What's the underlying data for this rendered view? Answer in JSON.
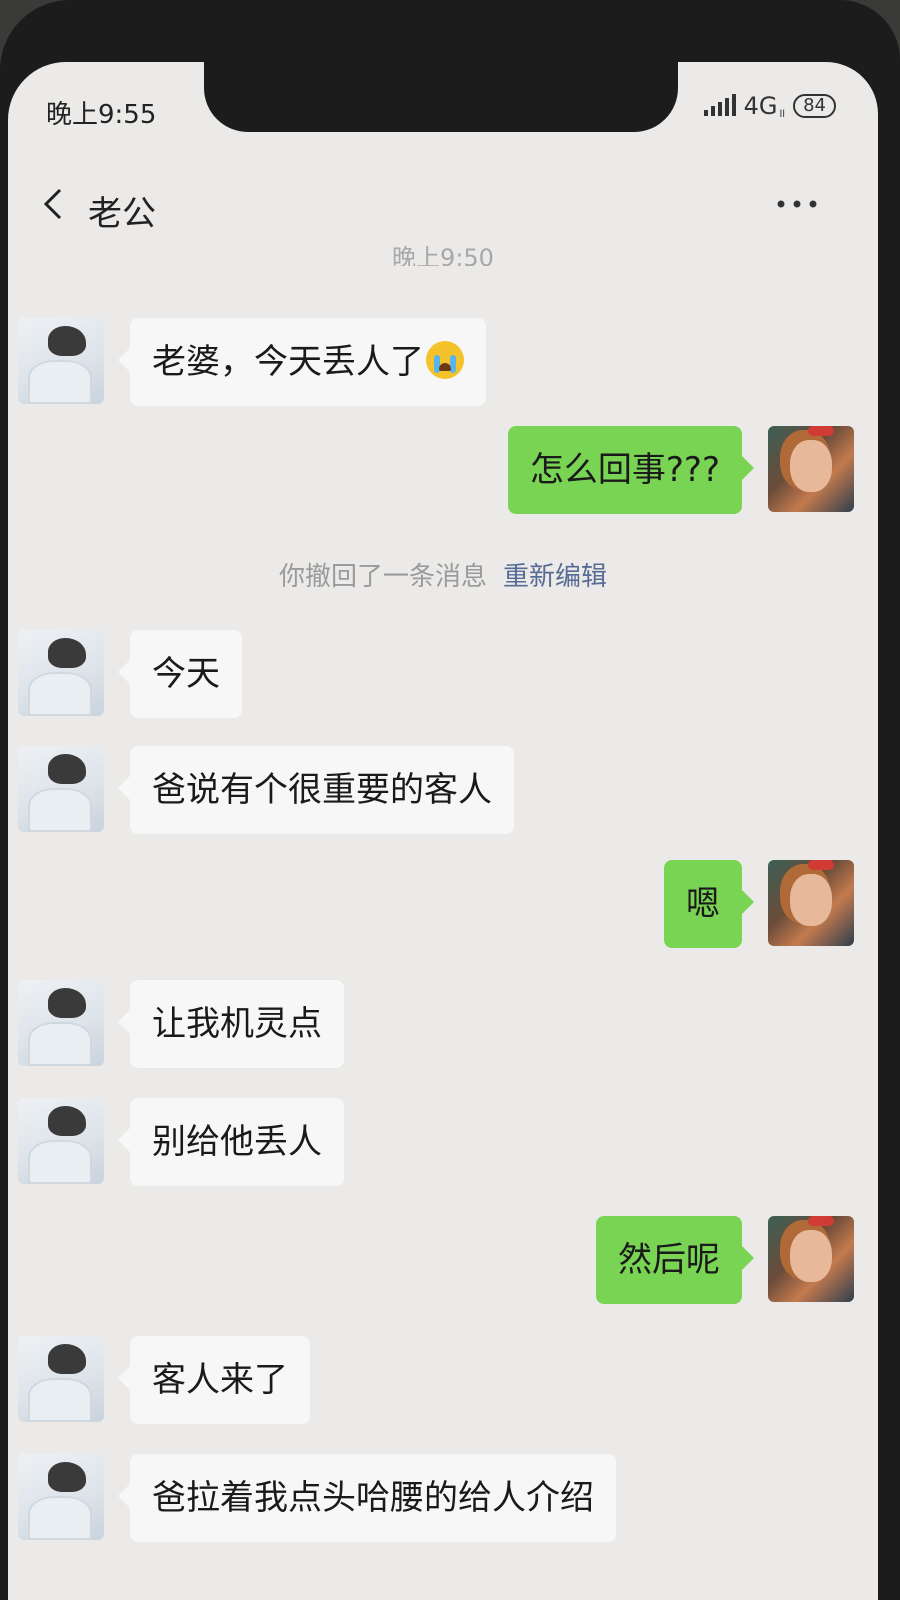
{
  "status_bar": {
    "time": "晚上9:55",
    "network": "4G",
    "network_sub": "ll",
    "battery": "84"
  },
  "header": {
    "back_icon": "chevron-left-icon",
    "title": "老公",
    "more_icon": "more-dots-icon"
  },
  "timestamp": "晚上9:50",
  "system_notice": {
    "text": "你撤回了一条消息",
    "action": "重新编辑"
  },
  "messages": [
    {
      "side": "left",
      "text": "老婆，今天丢人了",
      "emoji": "loudly-crying-face"
    },
    {
      "side": "right",
      "text": "怎么回事???"
    },
    {
      "side": "left",
      "text": "今天"
    },
    {
      "side": "left",
      "text": "爸说有个很重要的客人"
    },
    {
      "side": "right",
      "text": "嗯"
    },
    {
      "side": "left",
      "text": "让我机灵点"
    },
    {
      "side": "left",
      "text": "别给他丢人"
    },
    {
      "side": "right",
      "text": "然后呢"
    },
    {
      "side": "left",
      "text": "客人来了"
    },
    {
      "side": "left",
      "text": "爸拉着我点头哈腰的给人介绍"
    }
  ],
  "colors": {
    "background": "#ebeae8",
    "my_bubble": "#7ad454",
    "their_bubble": "#f7f7f7",
    "link": "#576b95"
  }
}
